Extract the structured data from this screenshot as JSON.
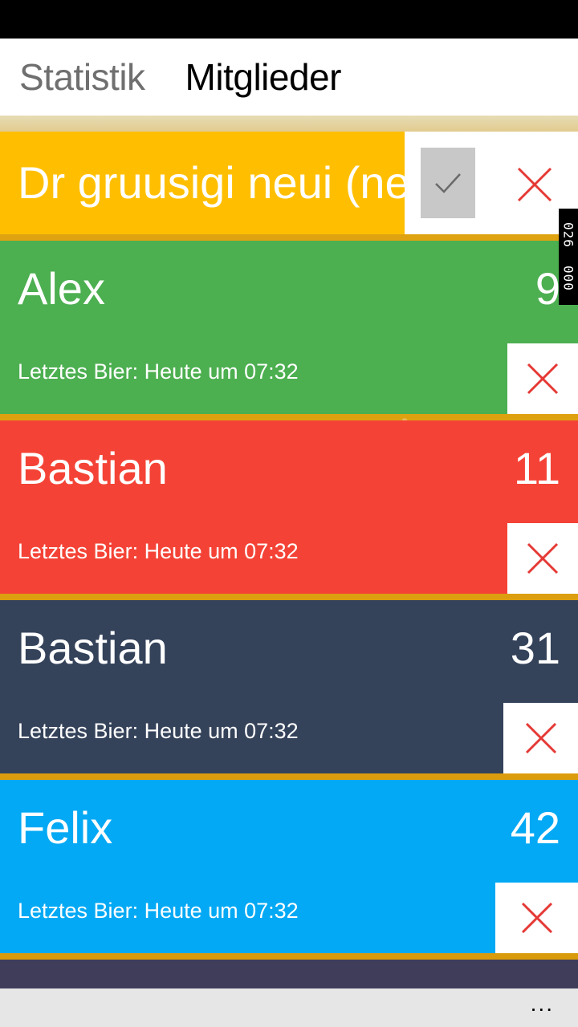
{
  "header": {
    "tabs": [
      {
        "label": "Statistik",
        "active": false
      },
      {
        "label": "Mitglieder",
        "active": true
      }
    ]
  },
  "new_member": {
    "value": "Dr gruusigi neui (ne",
    "color": "#ffbf00"
  },
  "members": [
    {
      "name": "Alex",
      "count": "9",
      "last": "Letztes Bier: Heute um 07:32",
      "color": "#4caf50"
    },
    {
      "name": "Bastian",
      "count": "11",
      "last": "Letztes Bier: Heute um 07:32",
      "color": "#f44336"
    },
    {
      "name": "Bastian",
      "count": "31",
      "last": "Letztes Bier: Heute um 07:32",
      "color": "#34425a"
    },
    {
      "name": "Felix",
      "count": "42",
      "last": "Letztes Bier: Heute um 07:32",
      "color": "#03a9f4"
    }
  ],
  "side_counter": [
    "026",
    "000"
  ],
  "app_bar": {
    "more_label": "..."
  },
  "icons": {
    "confirm": "check-icon",
    "cancel": "close-icon",
    "delete": "close-icon",
    "delete_color": "#e53935"
  }
}
